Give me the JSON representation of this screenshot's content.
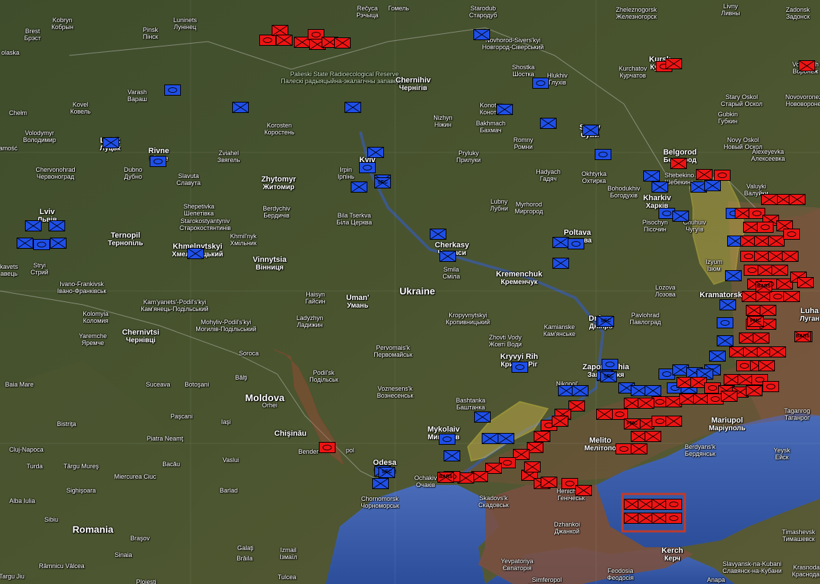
{
  "colors": {
    "friendly": "#1f4fe8",
    "hostile": "#ee1414",
    "occupied_fill": "#c8b24a",
    "sea": "#3b5ba8",
    "land": "#3e4a2c"
  },
  "places": [
    {
      "id": "recyca",
      "en": "Rečyca",
      "uk": "Рэчыца"
    },
    {
      "id": "homel",
      "en": "Гомель",
      "uk": ""
    },
    {
      "id": "starodub",
      "en": "Starodub",
      "uk": "Стародуб"
    },
    {
      "id": "zheleznogorsk",
      "en": "Zheleznogorsk",
      "uk": "Железногорск"
    },
    {
      "id": "livny",
      "en": "Livny",
      "uk": "Ливны"
    },
    {
      "id": "zadonsk",
      "en": "Zadonsk",
      "uk": "Задонск"
    },
    {
      "id": "kobryn",
      "en": "Kobryn",
      "uk": "Кобрын"
    },
    {
      "id": "pinsk",
      "en": "Pinsk",
      "uk": "Пінск"
    },
    {
      "id": "luninets",
      "en": "Luninets",
      "uk": "Лунінец"
    },
    {
      "id": "brest",
      "en": "Brest",
      "uk": "Брэст"
    },
    {
      "id": "novhorod",
      "en": "Novhorod-Sivers'kyi",
      "uk": "Новгород-Сіверський"
    },
    {
      "id": "polesie",
      "en": "Palieski State Radioecological Reserve",
      "uk": "Палескі радыяцыйна-экалагічны запаведнік"
    },
    {
      "id": "kursk",
      "en": "Kursk",
      "uk": "Курск"
    },
    {
      "id": "voronezh",
      "en": "Voronezh",
      "uk": "Воронеж"
    },
    {
      "id": "kurchatov",
      "en": "Kurchatov",
      "uk": "Курчатов"
    },
    {
      "id": "chernihiv",
      "en": "Chernihiv",
      "uk": "Чернігів"
    },
    {
      "id": "shostka",
      "en": "Shostka",
      "uk": "Шостка"
    },
    {
      "id": "hlukhiv",
      "en": "Hlukhiv",
      "uk": "Глухів"
    },
    {
      "id": "staryoskol",
      "en": "Stary Oskol",
      "uk": "Старый Оскол"
    },
    {
      "id": "gubkin",
      "en": "Gubkin",
      "uk": "Губкин"
    },
    {
      "id": "novovoronezh",
      "en": "Novovoronezh",
      "uk": "Нововоронеж"
    },
    {
      "id": "chelm",
      "en": "Chełm",
      "uk": ""
    },
    {
      "id": "kovel",
      "en": "Kovel",
      "uk": "Ковель"
    },
    {
      "id": "varash",
      "en": "Varash",
      "uk": "Вараш"
    },
    {
      "id": "korosten",
      "en": "Korosten",
      "uk": "Коростень"
    },
    {
      "id": "nizhyn",
      "en": "Nizhyn",
      "uk": "Ніжин"
    },
    {
      "id": "konotop",
      "en": "Konotop",
      "uk": "Конотоп"
    },
    {
      "id": "bakhmach",
      "en": "Bakhmach",
      "uk": "Бахмач"
    },
    {
      "id": "sumy",
      "en": "Sumy",
      "uk": "Суми"
    },
    {
      "id": "novyoskol",
      "en": "Novy Oskol",
      "uk": "Новый Оскол"
    },
    {
      "id": "volodymyr",
      "en": "Volodymyr",
      "uk": "Володимир"
    },
    {
      "id": "lutsk",
      "en": "Lutsk",
      "uk": "Луцьк"
    },
    {
      "id": "rivne",
      "en": "Rivne",
      "uk": "Рівне"
    },
    {
      "id": "zviahel",
      "en": "Zviahel",
      "uk": "Звягель"
    },
    {
      "id": "kyiv",
      "en": "Kyiv",
      "uk": ""
    },
    {
      "id": "romny",
      "en": "Romny",
      "uk": "Ромни"
    },
    {
      "id": "pryluky",
      "en": "Pryluky",
      "uk": "Прилуки"
    },
    {
      "id": "belgorod",
      "en": "Belgorod",
      "uk": "Белгород"
    },
    {
      "id": "alexeyevka",
      "en": "Alexeyevka",
      "uk": "Алексеевка"
    },
    {
      "id": "chervonohrad",
      "en": "Chervonohrad",
      "uk": "Червоноград"
    },
    {
      "id": "dubno",
      "en": "Dubno",
      "uk": "Дубно"
    },
    {
      "id": "slavuta",
      "en": "Slavuta",
      "uk": "Славута"
    },
    {
      "id": "zhytomyr",
      "en": "Zhytomyr",
      "uk": "Житомир"
    },
    {
      "id": "irpin",
      "en": "Irpin",
      "uk": "Ірпінь"
    },
    {
      "id": "hadyach",
      "en": "Hadyach",
      "uk": "Гадяч"
    },
    {
      "id": "okhtyrka",
      "en": "Okhtyrka",
      "uk": "Охтирка"
    },
    {
      "id": "shebekino",
      "en": "Shebekino",
      "uk": "Шебекино"
    },
    {
      "id": "bohodukhiv",
      "en": "Bohodukhiv",
      "uk": "Богодухів"
    },
    {
      "id": "valuyki",
      "en": "Valuyki",
      "uk": "Валуйки"
    },
    {
      "id": "lviv",
      "en": "Lviv",
      "uk": "Львів"
    },
    {
      "id": "shepetivka",
      "en": "Shepetivka",
      "uk": "Шепетівка"
    },
    {
      "id": "berdychiv",
      "en": "Berdychiv",
      "uk": "Бердичів"
    },
    {
      "id": "bilatserkva",
      "en": "Bila Tserkva",
      "uk": "Біла Церква"
    },
    {
      "id": "lubny",
      "en": "Lubny",
      "uk": "Лубни"
    },
    {
      "id": "myrhorod",
      "en": "Myrhorod",
      "uk": "Миргород"
    },
    {
      "id": "kharkiv",
      "en": "Kharkiv",
      "uk": "Харків"
    },
    {
      "id": "pisochyn",
      "en": "Pisochyn",
      "uk": "Пісочин"
    },
    {
      "id": "chuhuiv",
      "en": "Chuhuiv",
      "uk": "Чугуїв"
    },
    {
      "id": "starokostiantyniv",
      "en": "Starokostyantyniv",
      "uk": "Старокостянтинів"
    },
    {
      "id": "ternopil",
      "en": "Ternopil",
      "uk": "Тернопіль"
    },
    {
      "id": "khmelnytskyi",
      "en": "Khmelnytskyi",
      "uk": "Хмельницький"
    },
    {
      "id": "khmilnyk",
      "en": "Khmil'nyk",
      "uk": "Хмільник"
    },
    {
      "id": "cherkasy",
      "en": "Cherkasy",
      "uk": "Черкаси"
    },
    {
      "id": "poltava",
      "en": "Poltava",
      "uk": "Полтава"
    },
    {
      "id": "izium",
      "en": "Izyum",
      "uk": "Ізюм"
    },
    {
      "id": "stryi",
      "en": "Stryi",
      "uk": "Стрий"
    },
    {
      "id": "vinnytsia",
      "en": "Vinnytsia",
      "uk": "Вінниця"
    },
    {
      "id": "smila",
      "en": "Smila",
      "uk": "Сміла"
    },
    {
      "id": "kremenchuk",
      "en": "Kremenchuk",
      "uk": "Кременчук"
    },
    {
      "id": "lozova",
      "en": "Lozova",
      "uk": "Лозова"
    },
    {
      "id": "ivanofrankivsk",
      "en": "Ivano-Frankivsk",
      "uk": "Івано-Франківськ"
    },
    {
      "id": "haisyn",
      "en": "Haisyn",
      "uk": "Гайсин"
    },
    {
      "id": "uman",
      "en": "Uman'",
      "uk": "Умань"
    },
    {
      "id": "ukraine",
      "en": "Ukraine",
      "uk": ""
    },
    {
      "id": "kramatorsk",
      "en": "Kramatorsk",
      "uk": ""
    },
    {
      "id": "kamianets",
      "en": "Kam'yanets'-Podil's'kyi",
      "uk": "Кам'янець-Подільський"
    },
    {
      "id": "kolomyia",
      "en": "Kolomyia",
      "uk": "Коломия"
    },
    {
      "id": "ladyzhyn",
      "en": "Ladyzhyn",
      "uk": "Ладижин"
    },
    {
      "id": "kropyvnytskyi",
      "en": "Kropyvnytskyi",
      "uk": "Кропивницький"
    },
    {
      "id": "dnipro",
      "en": "Dnipro",
      "uk": "Дніпро"
    },
    {
      "id": "pavlohrad",
      "en": "Pavlohrad",
      "uk": "Павлоград"
    },
    {
      "id": "luhansk",
      "en": "Luha",
      "uk": "Луган"
    },
    {
      "id": "chernivtsi",
      "en": "Chernivtsi",
      "uk": "Чернівці"
    },
    {
      "id": "mohyliv",
      "en": "Mohyliv-Podil's'kyi",
      "uk": "Могилів-Подільський"
    },
    {
      "id": "yaremche",
      "en": "Yaremche",
      "uk": "Яремче"
    },
    {
      "id": "kamianske",
      "en": "Kamianske",
      "uk": "Кам'янське"
    },
    {
      "id": "zhovtivody",
      "en": "Zhovti Vody",
      "uk": "Жовті Води"
    },
    {
      "id": "pervomaisk",
      "en": "Pervomais'k",
      "uk": "Первомайськ"
    },
    {
      "id": "kryvyirih",
      "en": "Kryvyi Rih",
      "uk": "Кривий Ріг"
    },
    {
      "id": "soroca",
      "en": "Soroca",
      "uk": ""
    },
    {
      "id": "podilsk",
      "en": "Podil'sk",
      "uk": "Подільськ"
    },
    {
      "id": "zaporizhzhia",
      "en": "Zaporizhzhia",
      "uk": "Запоріжжя"
    },
    {
      "id": "baiamare",
      "en": "Baia Mare",
      "uk": ""
    },
    {
      "id": "suceava",
      "en": "Suceava",
      "uk": ""
    },
    {
      "id": "botosani",
      "en": "Botoşani",
      "uk": ""
    },
    {
      "id": "balti",
      "en": "Bălţi",
      "uk": ""
    },
    {
      "id": "moldova",
      "en": "Moldova",
      "uk": ""
    },
    {
      "id": "orhei",
      "en": "Orhei",
      "uk": ""
    },
    {
      "id": "voznesensk",
      "en": "Voznesens'k",
      "uk": "Вознесенськ"
    },
    {
      "id": "bashtanka",
      "en": "Bashtanka",
      "uk": "Баштанка"
    },
    {
      "id": "nikopol",
      "en": "Nikopol'",
      "uk": ""
    },
    {
      "id": "taganrog",
      "en": "Taganrog",
      "uk": "Таганрог"
    },
    {
      "id": "mariupol",
      "en": "Mariupol",
      "uk": "Маріуполь"
    },
    {
      "id": "bistrita",
      "en": "Bistriţa",
      "uk": ""
    },
    {
      "id": "pascani",
      "en": "Paşcani",
      "uk": ""
    },
    {
      "id": "iasi",
      "en": "Iaşi",
      "uk": ""
    },
    {
      "id": "mykolaiv",
      "en": "Mykolaiv",
      "uk": "Миколаїв"
    },
    {
      "id": "clujnapoca",
      "en": "Cluj-Napoca",
      "uk": ""
    },
    {
      "id": "piatraneamt",
      "en": "Piatra Neamţ",
      "uk": ""
    },
    {
      "id": "chisinau",
      "en": "Chişinău",
      "uk": ""
    },
    {
      "id": "melitopol",
      "en": "Melito",
      "uk": "Мелітопо"
    },
    {
      "id": "berdyansk",
      "en": "Berdyans'k",
      "uk": "Бердянськ"
    },
    {
      "id": "yeysk",
      "en": "Yeysk",
      "uk": "Ейск"
    },
    {
      "id": "bender",
      "en": "Bender",
      "uk": ""
    },
    {
      "id": "tiraspol",
      "en": "pol",
      "uk": ""
    },
    {
      "id": "turda",
      "en": "Turda",
      "uk": ""
    },
    {
      "id": "targumures",
      "en": "Târgu Mureş",
      "uk": ""
    },
    {
      "id": "bacau",
      "en": "Bacău",
      "uk": ""
    },
    {
      "id": "vaslui",
      "en": "Vaslui",
      "uk": ""
    },
    {
      "id": "odesa",
      "en": "Odesa",
      "uk": "Одеса"
    },
    {
      "id": "ochakiv",
      "en": "Ochakiv",
      "uk": "Очаків"
    },
    {
      "id": "miercurea",
      "en": "Miercurea Ciuc",
      "uk": ""
    },
    {
      "id": "sighisoara",
      "en": "Sighişoara",
      "uk": ""
    },
    {
      "id": "albaiulia",
      "en": "Alba Iulia",
      "uk": ""
    },
    {
      "id": "barlad",
      "en": "Barlad",
      "uk": ""
    },
    {
      "id": "chornomorsk",
      "en": "Chornomorsk",
      "uk": "Чорноморськ"
    },
    {
      "id": "skadovsk",
      "en": "Skadovs'k",
      "uk": "Скадовськ"
    },
    {
      "id": "henichesk",
      "en": "Henichesk",
      "uk": "Генічеськ"
    },
    {
      "id": "sibiu",
      "en": "Sibiu",
      "uk": ""
    },
    {
      "id": "romania",
      "en": "Romania",
      "uk": ""
    },
    {
      "id": "brasov",
      "en": "Braşov",
      "uk": ""
    },
    {
      "id": "dzhankoi",
      "en": "Dzhankoi",
      "uk": "Джанкой"
    },
    {
      "id": "timashevsk",
      "en": "Timashevsk",
      "uk": "Тимашевск"
    },
    {
      "id": "sinaia",
      "en": "Sinaia",
      "uk": ""
    },
    {
      "id": "galati",
      "en": "Galaţi",
      "uk": ""
    },
    {
      "id": "izmail",
      "en": "Izmail",
      "uk": "Ізмаїл"
    },
    {
      "id": "kerch",
      "en": "Kerch",
      "uk": "Керч"
    },
    {
      "id": "ramnicu",
      "en": "Râmnicu Vâlcea",
      "uk": ""
    },
    {
      "id": "braila",
      "en": "Brăila",
      "uk": ""
    },
    {
      "id": "yevpatoriya",
      "en": "Yevpatoriya",
      "uk": "Євпаторія"
    },
    {
      "id": "slavyansk",
      "en": "Slavyansk-na-Kubani",
      "uk": "Славянск-на-Кубани"
    },
    {
      "id": "krasnodar",
      "en": "Krasnodar",
      "uk": "Краснодар"
    },
    {
      "id": "tulcea",
      "en": "Tulcea",
      "uk": ""
    },
    {
      "id": "feodosia",
      "en": "Feodosia",
      "uk": "Феодосія"
    },
    {
      "id": "anapa",
      "en": "Anapa",
      "uk": "Анапа"
    },
    {
      "id": "simferopol",
      "en": "Simferopol",
      "uk": "Сімферополь"
    },
    {
      "id": "ploiesti",
      "en": "Ploieşti",
      "uk": ""
    },
    {
      "id": "targujiu",
      "en": "Targu Jiu",
      "uk": ""
    },
    {
      "id": "kavets",
      "en": "kavets",
      "uk": "авець"
    },
    {
      "id": "zamosc",
      "en": "amość",
      "uk": ""
    },
    {
      "id": "olaska",
      "en": "olaska",
      "uk": ""
    }
  ],
  "unit_tags": {
    "sec": "SEC",
    "bars": "BARS",
    "pmc": "PMC"
  }
}
